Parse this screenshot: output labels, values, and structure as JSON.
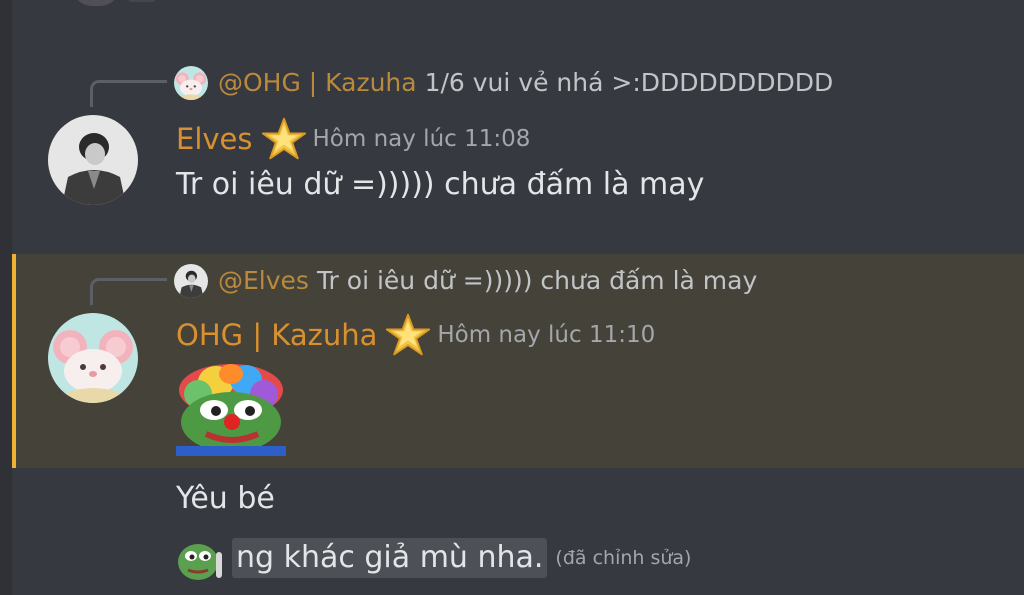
{
  "messages": [
    {
      "reply": {
        "name": "@OHG | Kazuha",
        "text": "1/6 vui vẻ nhá >:DDDDDDDDDD",
        "avatar_icon": "mouse-avatar-icon"
      },
      "author": {
        "name": "Elves",
        "badge_icon": "star-badge-icon",
        "avatar_icon": "elves-avatar-icon"
      },
      "timestamp": "Hôm nay lúc 11:08",
      "content": "Tr oi iêu dữ =))))) chưa đấm là may"
    },
    {
      "highlighted": true,
      "reply": {
        "name": "@Elves",
        "text": "Tr oi iêu dữ =))))) chưa đấm là may",
        "avatar_icon": "elves-avatar-icon"
      },
      "author": {
        "name": "OHG | Kazuha",
        "badge_icon": "star-badge-icon",
        "avatar_icon": "mouse-avatar-icon"
      },
      "timestamp": "Hôm nay lúc 11:10",
      "content_emoji": "clown-pepe-emoji"
    }
  ],
  "continuation": {
    "line1": "Yêu bé",
    "line2_emoji": "pepe-emoji",
    "line2_text": "ng khác giả mù nha.",
    "edited_label": "(đã chỉnh sửa)"
  },
  "colors": {
    "background": "#36393f",
    "highlight_bg": "#45423a",
    "highlight_border": "#f0b232",
    "username": "#d9902f",
    "timestamp": "#a3a6aa"
  }
}
